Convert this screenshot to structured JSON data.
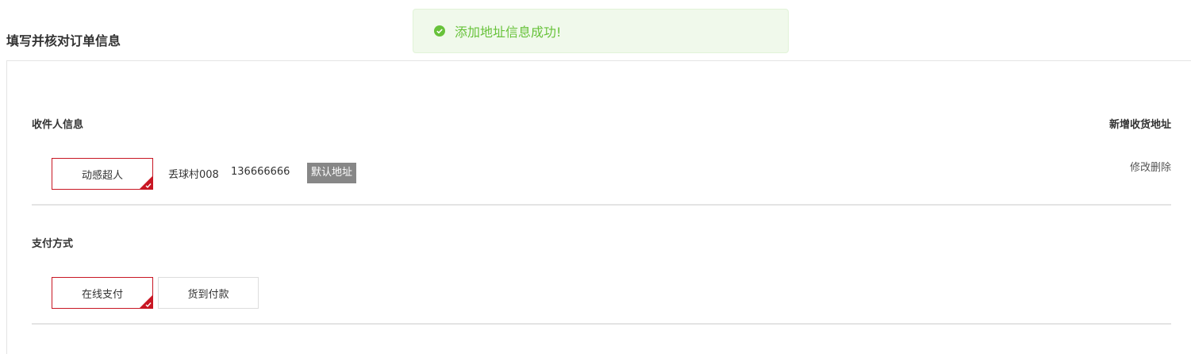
{
  "page": {
    "title": "填写并核对订单信息"
  },
  "toast": {
    "message": "添加地址信息成功!",
    "color": "#67c23a"
  },
  "receiver": {
    "section_title": "收件人信息",
    "add_address_label": "新增收货地址",
    "name": "动感超人",
    "address": "丢球村008",
    "phone": "136666666",
    "default_badge": "默认地址",
    "edit_label": "修改",
    "delete_label": "删除"
  },
  "payment": {
    "section_title": "支付方式",
    "options": [
      {
        "label": "在线支付",
        "selected": true
      },
      {
        "label": "货到付款",
        "selected": false
      }
    ]
  },
  "colors": {
    "accent": "#c81623",
    "badge_bg": "#878787"
  }
}
